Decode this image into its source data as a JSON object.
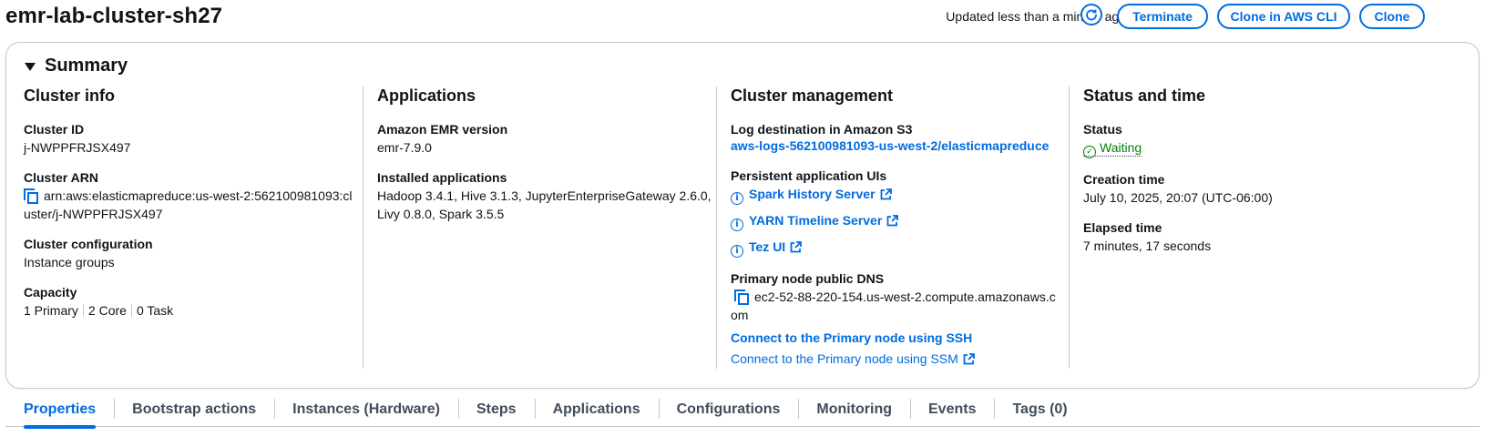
{
  "header": {
    "title": "emr-lab-cluster-sh27",
    "updated_text": "Updated less than a minute ago",
    "buttons": {
      "terminate": "Terminate",
      "clone_cli": "Clone in AWS CLI",
      "clone": "Clone"
    }
  },
  "summary": {
    "heading": "Summary",
    "cluster_info": {
      "heading": "Cluster info",
      "cluster_id_label": "Cluster ID",
      "cluster_id": "j-NWPPFRJSX497",
      "arn_label": "Cluster ARN",
      "arn_line1": "arn:aws:elasticmapreduce:us-west-2:562100981093:cl",
      "arn_line2": "uster/j-NWPPFRJSX497",
      "config_label": "Cluster configuration",
      "config_value": "Instance groups",
      "capacity_label": "Capacity",
      "capacity": [
        "1 Primary",
        "2 Core",
        "0 Task"
      ]
    },
    "applications": {
      "heading": "Applications",
      "emr_version_label": "Amazon EMR version",
      "emr_version": "emr-7.9.0",
      "installed_label": "Installed applications",
      "installed_line1": "Hadoop 3.4.1, Hive 3.1.3, JupyterEnterpriseGateway 2.6.0,",
      "installed_line2": "Livy 0.8.0, Spark 3.5.5"
    },
    "cluster_management": {
      "heading": "Cluster management",
      "log_label": "Log destination in Amazon S3",
      "log_link": "aws-logs-562100981093-us-west-2/elasticmapreduce",
      "persistent_label": "Persistent application UIs",
      "spark_link": "Spark History Server",
      "yarn_link": "YARN Timeline Server",
      "tez_link": "Tez UI",
      "dns_label": "Primary node public DNS",
      "dns_line1": "ec2-52-88-220-154.us-west-2.compute.amazonaws.c",
      "dns_line2": "om",
      "ssh_link": "Connect to the Primary node using SSH",
      "ssm_link": "Connect to the Primary node using SSM"
    },
    "status_time": {
      "heading": "Status and time",
      "status_label": "Status",
      "status_value": "Waiting",
      "creation_label": "Creation time",
      "creation_value": "July 10, 2025, 20:07 (UTC-06:00)",
      "elapsed_label": "Elapsed time",
      "elapsed_value": "7 minutes, 17 seconds"
    }
  },
  "tabs": [
    "Properties",
    "Bootstrap actions",
    "Instances (Hardware)",
    "Steps",
    "Applications",
    "Configurations",
    "Monitoring",
    "Events",
    "Tags (0)"
  ],
  "active_tab": 0,
  "colors": {
    "accent": "#006ce0",
    "success": "#037f0c",
    "border": "#c6c6cd"
  }
}
